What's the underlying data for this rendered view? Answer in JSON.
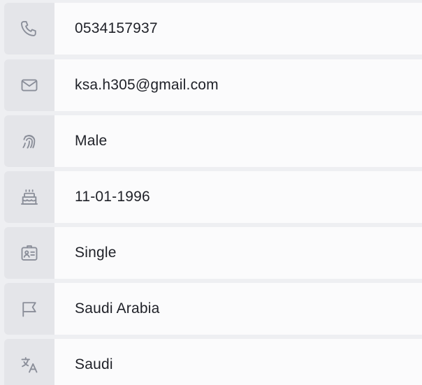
{
  "profile": {
    "rows": [
      {
        "icon": "phone-icon",
        "value": "0534157937"
      },
      {
        "icon": "mail-icon",
        "value": "ksa.h305@gmail.com"
      },
      {
        "icon": "fingerprint-icon",
        "value": "Male"
      },
      {
        "icon": "cake-icon",
        "value": "11-01-1996"
      },
      {
        "icon": "id-card-icon",
        "value": "Single"
      },
      {
        "icon": "flag-icon",
        "value": "Saudi Arabia"
      },
      {
        "icon": "translate-icon",
        "value": "Saudi"
      }
    ]
  },
  "colors": {
    "background": "#eeeff2",
    "icon_cell": "#e4e5e9",
    "value_cell": "#fbfbfc",
    "icon_stroke": "#8a8e99",
    "text": "#1f2128"
  }
}
